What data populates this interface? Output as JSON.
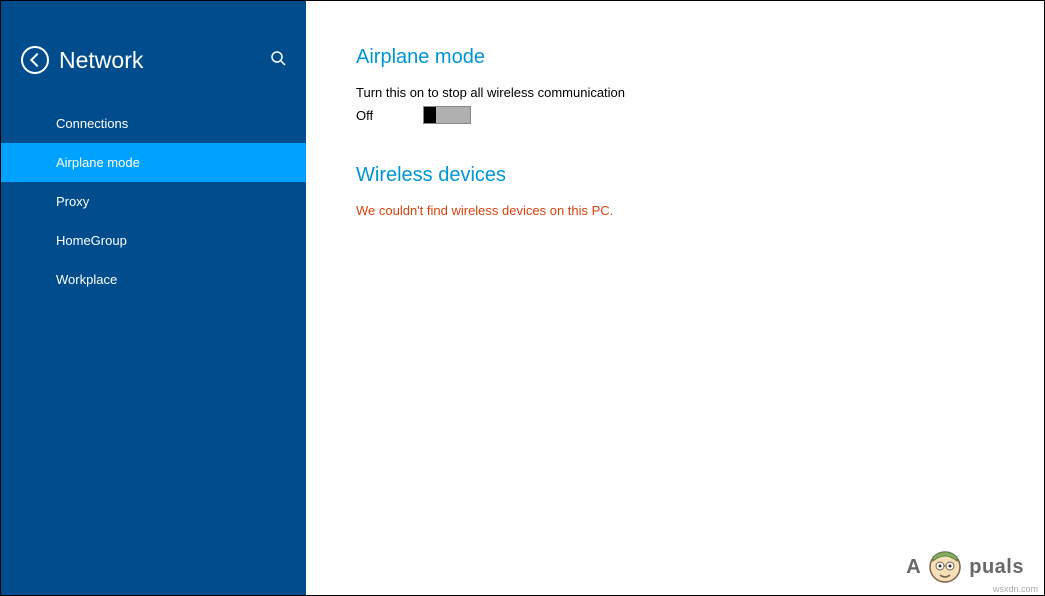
{
  "sidebar": {
    "title": "Network",
    "items": [
      {
        "label": "Connections",
        "selected": false
      },
      {
        "label": "Airplane mode",
        "selected": true
      },
      {
        "label": "Proxy",
        "selected": false
      },
      {
        "label": "HomeGroup",
        "selected": false
      },
      {
        "label": "Workplace",
        "selected": false
      }
    ]
  },
  "content": {
    "airplane": {
      "title": "Airplane mode",
      "description": "Turn this on to stop all wireless communication",
      "state_label": "Off"
    },
    "wireless": {
      "title": "Wireless devices",
      "error": "We couldn't find wireless devices on this PC."
    }
  },
  "watermark": {
    "prefix": "A",
    "suffix": "puals"
  },
  "footer": "wsxdn.com"
}
